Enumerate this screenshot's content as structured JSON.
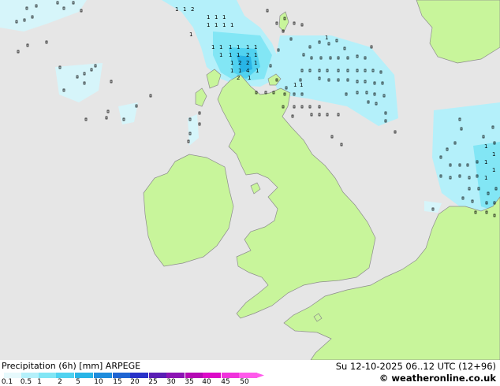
{
  "map": {
    "colors": {
      "sea": "#e6e6e6",
      "land": "#c8f59b",
      "coast": "#8c8c8c",
      "precip_light": "#b4f0fa",
      "precip_mid": "#64dcf0",
      "precip_strong": "#3cc8e6"
    }
  },
  "footer": {
    "title": "Precipitation (6h) [mm] ARPEGE",
    "datetime": "Su 12-10-2025 06..12 UTC (12+96)",
    "credit": "© weatheronline.co.uk"
  },
  "scale": {
    "labels": [
      "0.1",
      "0.5",
      "1",
      "2",
      "5",
      "10",
      "15",
      "20",
      "25",
      "30",
      "35",
      "40",
      "45",
      "50"
    ],
    "colors": [
      "#e6f9fc",
      "#b4f0fa",
      "#82e6f5",
      "#50d2f0",
      "#28b4e6",
      "#1e8cdc",
      "#1e64d2",
      "#2832c8",
      "#5a1eb4",
      "#8c14b4",
      "#b40ab4",
      "#dc0ac8",
      "#f032dc",
      "#ff5aeb"
    ]
  }
}
